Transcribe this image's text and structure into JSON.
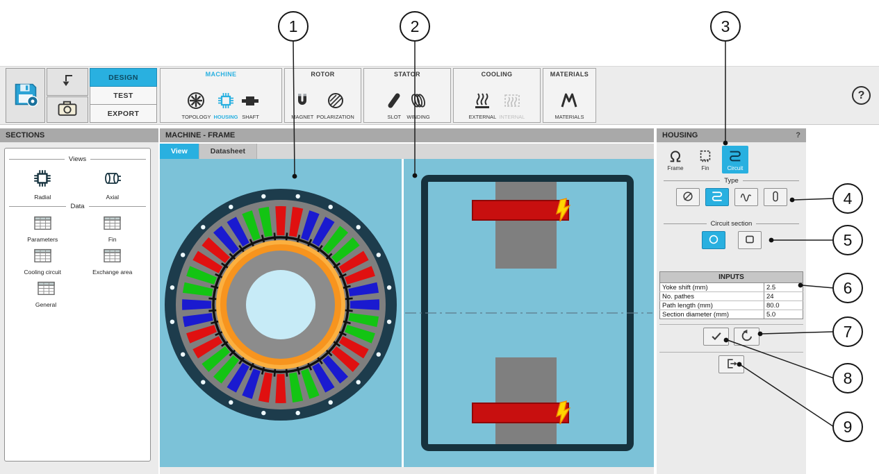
{
  "colors": {
    "accent": "#29b0e0",
    "panel_header_gray": "#a9a9a9",
    "view_background_blue": "#7cc2d8",
    "frame_navy": "#16323e",
    "slot_red": "#e01010",
    "slot_green": "#13c413",
    "slot_blue": "#1a1ad0",
    "rotor_orange": "#f7941e",
    "rotor_orange_light": "#fbb040",
    "winding_red": "#c80f0f",
    "bolt_yellow": "#ffd500"
  },
  "toolbar": {
    "help_label": "?",
    "mode_tabs": [
      {
        "label": "DESIGN",
        "active": true
      },
      {
        "label": "TEST",
        "active": false
      },
      {
        "label": "EXPORT",
        "active": false
      }
    ],
    "groups": [
      {
        "label": "MACHINE",
        "active": true,
        "items": [
          {
            "label": "TOPOLOGY",
            "icon": "topology-icon"
          },
          {
            "label": "HOUSING",
            "icon": "housing-icon",
            "active": true
          },
          {
            "label": "SHAFT",
            "icon": "shaft-icon"
          }
        ]
      },
      {
        "label": "ROTOR",
        "items": [
          {
            "label": "MAGNET",
            "icon": "magnet-icon"
          },
          {
            "label": "POLARIZATION",
            "icon": "polarization-icon"
          }
        ]
      },
      {
        "label": "STATOR",
        "items": [
          {
            "label": "SLOT",
            "icon": "slot-icon"
          },
          {
            "label": "WINDING",
            "icon": "winding-icon"
          }
        ]
      },
      {
        "label": "COOLING",
        "items": [
          {
            "label": "EXTERNAL",
            "icon": "external-cooling-icon"
          },
          {
            "label": "INTERNAL",
            "icon": "internal-cooling-icon",
            "disabled": true
          }
        ]
      },
      {
        "label": "MATERIALS",
        "items": [
          {
            "label": "MATERIALS",
            "icon": "materials-icon"
          }
        ]
      }
    ]
  },
  "sections_panel": {
    "title": "SECTIONS",
    "views_legend": "Views",
    "view_items": [
      {
        "label": "Radial",
        "icon": "radial-view-icon"
      },
      {
        "label": "Axial",
        "icon": "axial-view-icon"
      }
    ],
    "data_legend": "Data",
    "data_items": [
      {
        "label": "Parameters",
        "icon": "table-icon"
      },
      {
        "label": "Fin",
        "icon": "table-icon"
      },
      {
        "label": "Cooling circuit",
        "icon": "table-icon"
      },
      {
        "label": "Exchange area",
        "icon": "table-icon"
      },
      {
        "label": "General",
        "icon": "table-icon"
      }
    ]
  },
  "machine_panel": {
    "title": "MACHINE - FRAME",
    "tabs": [
      {
        "label": "View",
        "active": true
      },
      {
        "label": "Datasheet",
        "active": false
      }
    ]
  },
  "housing_panel": {
    "title": "HOUSING",
    "help_label": "?",
    "tabs": [
      {
        "label": "Frame",
        "icon": "frame-icon",
        "active": false
      },
      {
        "label": "Fin",
        "icon": "fin-icon",
        "active": false
      },
      {
        "label": "Circuit",
        "icon": "circuit-icon",
        "active": true
      }
    ],
    "type_legend": "Type",
    "type_options": [
      {
        "icon": "none-circuit-icon",
        "selected": false
      },
      {
        "icon": "serpentine-circuit-icon",
        "selected": true
      },
      {
        "icon": "wave-circuit-icon",
        "selected": false
      },
      {
        "icon": "axial-duct-icon",
        "selected": false
      }
    ],
    "circuit_section_legend": "Circuit section",
    "section_options": [
      {
        "icon": "circle-section-icon",
        "selected": true
      },
      {
        "icon": "square-section-icon",
        "selected": false
      }
    ],
    "inputs": {
      "title": "INPUTS",
      "rows": [
        {
          "label": "Yoke shift (mm)",
          "value": "2.5"
        },
        {
          "label": "No. pathes",
          "value": "24"
        },
        {
          "label": "Path length (mm)",
          "value": "80.0"
        },
        {
          "label": "Section diameter (mm)",
          "value": "5.0"
        }
      ]
    }
  },
  "radial_view": {
    "slot_count": 36,
    "bolt_hole_count": 20,
    "slot_colors": [
      "#e01010",
      "#1a1ad0",
      "#13c413"
    ]
  },
  "callouts": [
    {
      "label": "1"
    },
    {
      "label": "2"
    },
    {
      "label": "3"
    },
    {
      "label": "4"
    },
    {
      "label": "5"
    },
    {
      "label": "6"
    },
    {
      "label": "7"
    },
    {
      "label": "8"
    },
    {
      "label": "9"
    }
  ]
}
